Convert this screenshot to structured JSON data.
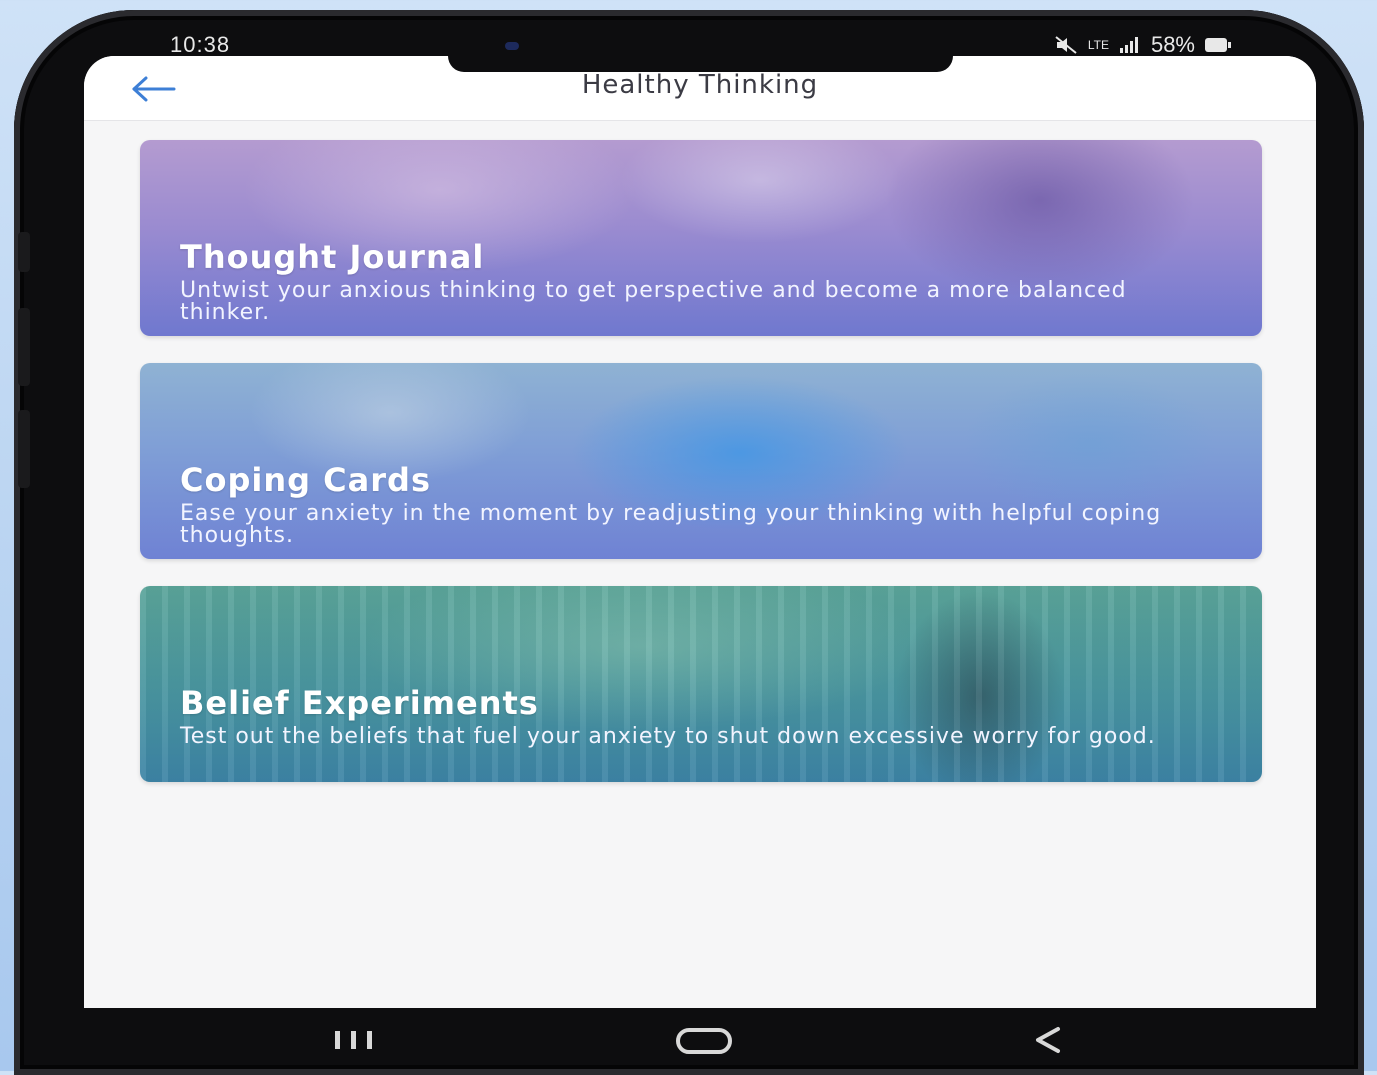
{
  "status_bar": {
    "time": "10:38",
    "battery": "58%",
    "network": "LTE"
  },
  "header": {
    "title": "Healthy Thinking",
    "back_icon": "arrow-left-icon",
    "accent_color": "#3d7fd6"
  },
  "cards": [
    {
      "title": "Thought Journal",
      "description": "Untwist your anxious thinking to get perspective and become a more balanced thinker."
    },
    {
      "title": "Coping Cards",
      "description": "Ease your anxiety in the moment by readjusting your thinking with helpful coping thoughts."
    },
    {
      "title": "Belief Experiments",
      "description": "Test out the beliefs that fuel your anxiety to shut down excessive worry for good."
    }
  ],
  "nav_bar": {
    "recent_icon": "recent-apps-icon",
    "home_icon": "home-icon",
    "back_icon": "back-triangle-icon"
  }
}
